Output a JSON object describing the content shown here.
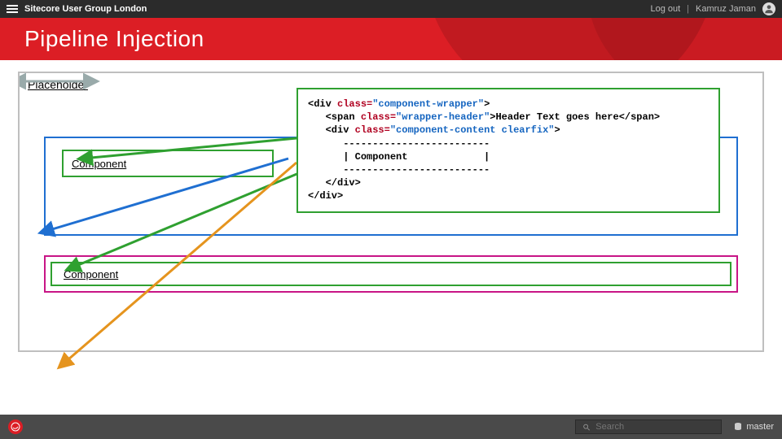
{
  "topbar": {
    "group_title": "Sitecore User Group London",
    "logout": "Log out",
    "username": "Kamruz Jaman"
  },
  "banner": {
    "title": "Pipeline Injection"
  },
  "diagram": {
    "placeholder_label": "Placeholder",
    "component1_label": "Component",
    "component2_label": "Component"
  },
  "code": {
    "line1_open": "<div ",
    "line1_attr": "class=",
    "line1_val": "\"component-wrapper\"",
    "line1_close": ">",
    "line2_open": "<span ",
    "line2_attr": "class=",
    "line2_val": "\"wrapper-header\"",
    "line2_close": ">",
    "line2_text": "Header Text goes here",
    "line2_end": "</span>",
    "line3_open": "<div ",
    "line3_attr": "class=",
    "line3_val": "\"component-content clearfix\"",
    "line3_close": ">",
    "dash": "-------------------------",
    "comp_row": "| Component             |",
    "line_close_div": "</div>",
    "line_close_outer": "</div>"
  },
  "footer": {
    "search_placeholder": "Search",
    "db_label": "master"
  }
}
